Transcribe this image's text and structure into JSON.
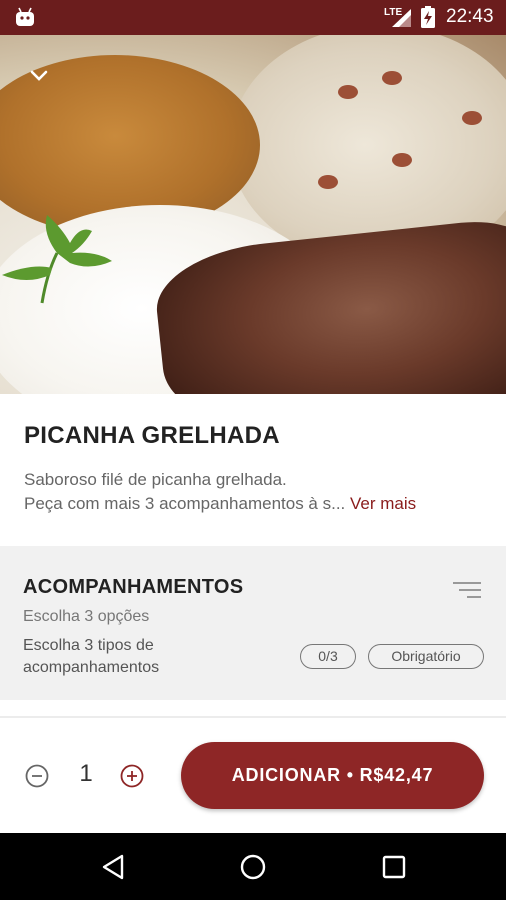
{
  "status_bar": {
    "network": "LTE",
    "time": "22:43"
  },
  "icons": {
    "app": "android-robot-icon",
    "signal": "signal-icon",
    "battery": "battery-charging-icon",
    "collapse": "chevron-down-icon",
    "filter": "filter-icon",
    "minus": "minus-circle-icon",
    "plus": "plus-circle-icon",
    "back": "nav-back-icon",
    "home": "nav-home-icon",
    "recents": "nav-recents-icon"
  },
  "product": {
    "title": "PICANHA GRELHADA",
    "description_line1": "Saboroso filé de picanha grelhada.",
    "description_line2": "Peça com mais 3 acompanhamentos à s...",
    "see_more": "Ver mais"
  },
  "section": {
    "title": "ACOMPANHAMENTOS",
    "subtitle": "Escolha 3 opções",
    "description": "Escolha 3 tipos de acompanhamentos",
    "count": "0/3",
    "required": "Obrigatório"
  },
  "cart": {
    "quantity": "1",
    "add_label": "ADICIONAR • R$42,47"
  },
  "colors": {
    "brand": "#8e2626",
    "status_bar": "#6b1d1d",
    "link": "#8a1c1c"
  }
}
